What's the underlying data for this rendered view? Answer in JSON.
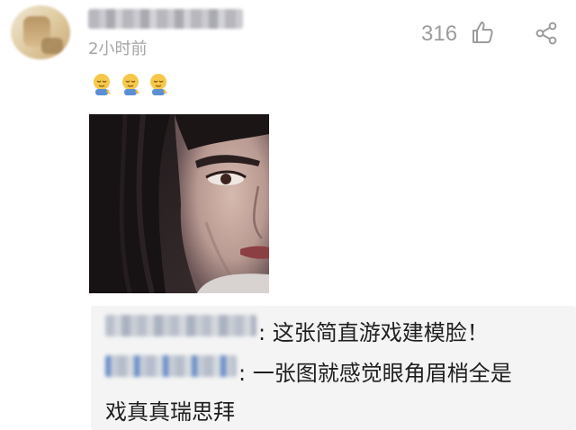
{
  "comment": {
    "timestamp": "2小时前",
    "like_count": "316",
    "emojis": [
      "sleepy-face-emoji",
      "sleepy-face-emoji",
      "sleepy-face-emoji"
    ],
    "image": "face-closeup-photo"
  },
  "icons": {
    "like": "thumb-up-icon",
    "share": "share-icon"
  },
  "replies": [
    {
      "text": ": 这张简直游戏建模脸！"
    },
    {
      "text_line1": ": 一张图就感觉眼角眉梢全是",
      "text_line2": "戏真真瑞思拜"
    }
  ],
  "colors": {
    "muted_text": "#a6a6a6",
    "reply_bg": "#f4f4f4",
    "body_text": "#1f1f1f",
    "link_blue": "#6b8fc7"
  }
}
